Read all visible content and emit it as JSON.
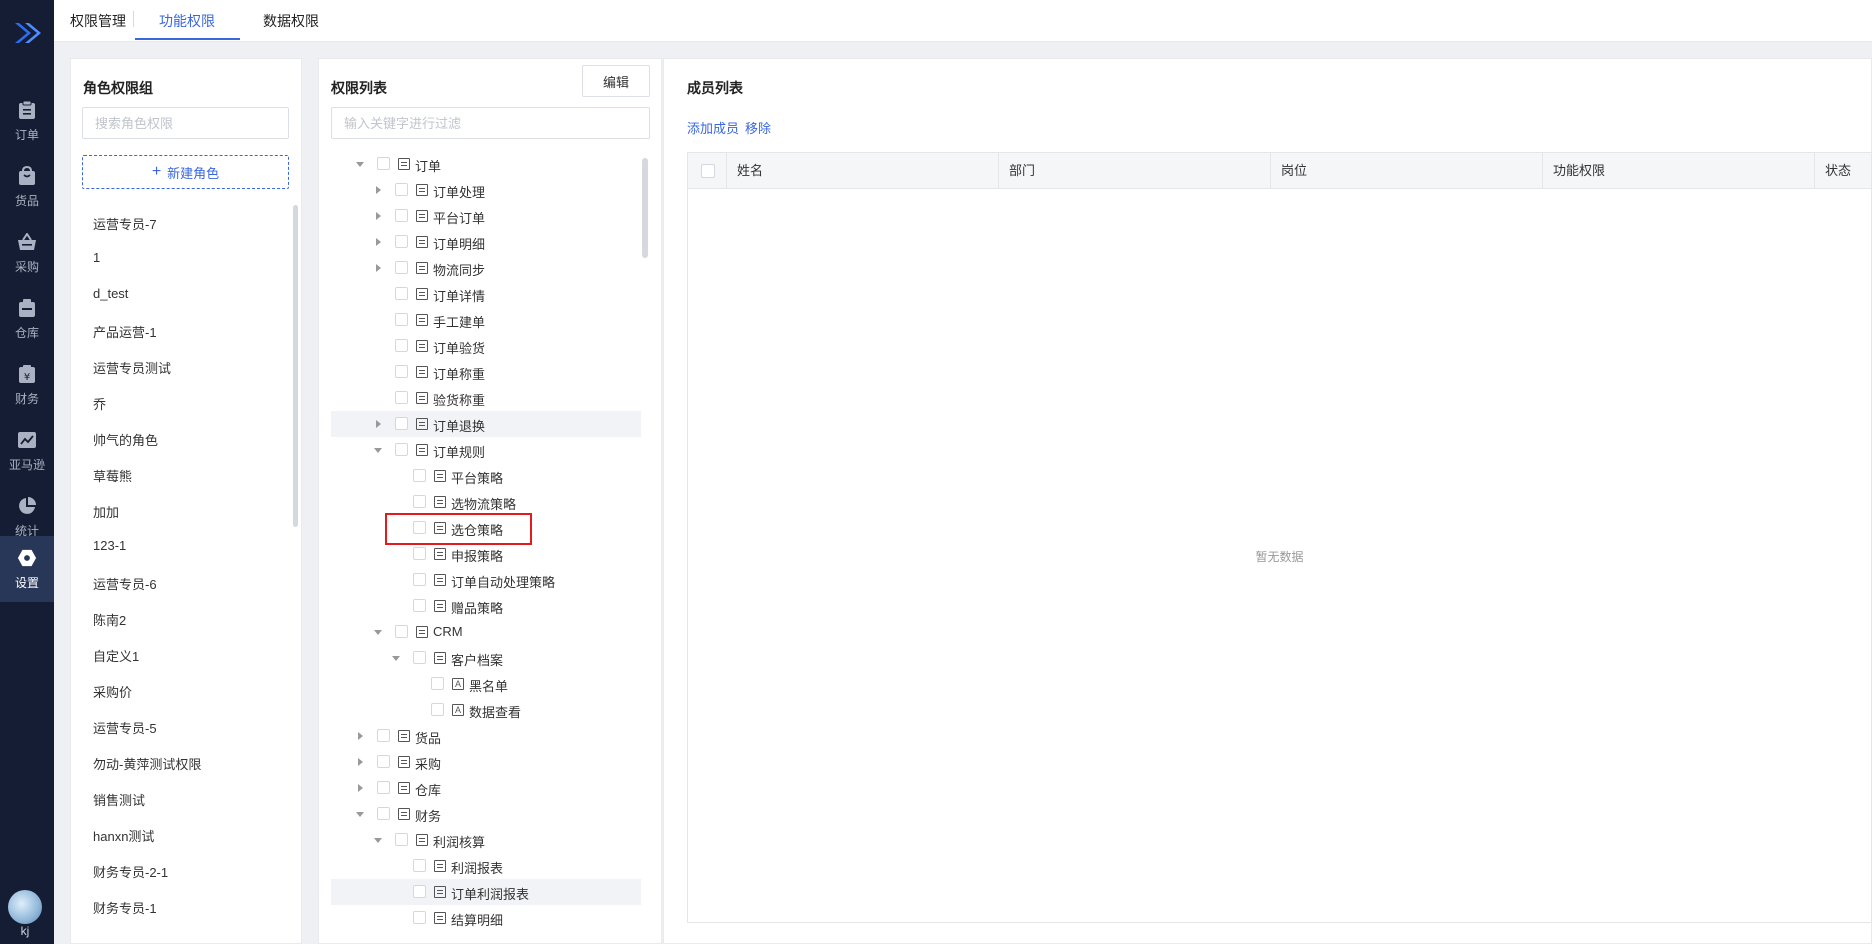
{
  "sidebar": {
    "items": [
      {
        "label": "订单",
        "icon": "clipboard-icon"
      },
      {
        "label": "货品",
        "icon": "shopping-bag-icon"
      },
      {
        "label": "采购",
        "icon": "basket-icon"
      },
      {
        "label": "仓库",
        "icon": "warehouse-icon"
      },
      {
        "label": "财务",
        "icon": "finance-icon"
      },
      {
        "label": "亚马逊",
        "icon": "trend-chart-icon"
      },
      {
        "label": "统计",
        "icon": "pie-chart-icon"
      },
      {
        "label": "设置",
        "icon": "settings-icon"
      }
    ],
    "active": "设置",
    "user_label": "kj"
  },
  "topbar": {
    "title": "权限管理",
    "tabs": [
      "功能权限",
      "数据权限"
    ],
    "active_tab": "功能权限"
  },
  "roles_panel": {
    "title": "角色权限组",
    "search_placeholder": "搜索角色权限",
    "new_role_label": "新建角色",
    "roles": [
      "运营专员-7",
      "1",
      "d_test",
      "产品运营-1",
      "运营专员测试",
      "乔",
      "帅气的角色",
      "草莓熊",
      "加加",
      "123-1",
      "运营专员-6",
      "陈南2",
      "自定义1",
      "采购价",
      "运营专员-5",
      "勿动-黄萍测试权限",
      "销售测试",
      "hanxn测试",
      "财务专员-2-1",
      "财务专员-1"
    ]
  },
  "permissions_panel": {
    "title": "权限列表",
    "edit_label": "编辑",
    "filter_placeholder": "输入关键字进行过滤",
    "tree": [
      {
        "label": "订单",
        "level": 0,
        "arrow": "down",
        "icon": "page-icon"
      },
      {
        "label": "订单处理",
        "level": 1,
        "arrow": "right",
        "icon": "page-icon"
      },
      {
        "label": "平台订单",
        "level": 1,
        "arrow": "right",
        "icon": "page-icon"
      },
      {
        "label": "订单明细",
        "level": 1,
        "arrow": "right",
        "icon": "page-icon"
      },
      {
        "label": "物流同步",
        "level": 1,
        "arrow": "right",
        "icon": "page-icon"
      },
      {
        "label": "订单详情",
        "level": 1,
        "arrow": "none",
        "icon": "page-icon"
      },
      {
        "label": "手工建单",
        "level": 1,
        "arrow": "none",
        "icon": "page-icon"
      },
      {
        "label": "订单验货",
        "level": 1,
        "arrow": "none",
        "icon": "page-icon"
      },
      {
        "label": "订单称重",
        "level": 1,
        "arrow": "none",
        "icon": "page-icon"
      },
      {
        "label": "验货称重",
        "level": 1,
        "arrow": "none",
        "icon": "page-icon"
      },
      {
        "label": "订单退换",
        "level": 1,
        "arrow": "right",
        "icon": "page-icon",
        "hover": true
      },
      {
        "label": "订单规则",
        "level": 1,
        "arrow": "down",
        "icon": "page-icon"
      },
      {
        "label": "平台策略",
        "level": 2,
        "arrow": "none",
        "icon": "page-icon"
      },
      {
        "label": "选物流策略",
        "level": 2,
        "arrow": "none",
        "icon": "page-icon"
      },
      {
        "label": "选仓策略",
        "level": 2,
        "arrow": "none",
        "icon": "page-icon"
      },
      {
        "label": "申报策略",
        "level": 2,
        "arrow": "none",
        "icon": "page-icon"
      },
      {
        "label": "订单自动处理策略",
        "level": 2,
        "arrow": "none",
        "icon": "page-icon"
      },
      {
        "label": "赠品策略",
        "level": 2,
        "arrow": "none",
        "icon": "page-icon"
      },
      {
        "label": "CRM",
        "level": 1,
        "arrow": "down",
        "icon": "page-icon"
      },
      {
        "label": "客户档案",
        "level": 2,
        "arrow": "down",
        "icon": "page-icon"
      },
      {
        "label": "黑名单",
        "level": 3,
        "arrow": "none",
        "icon": "action-icon"
      },
      {
        "label": "数据查看",
        "level": 3,
        "arrow": "none",
        "icon": "action-icon"
      },
      {
        "label": "货品",
        "level": 0,
        "arrow": "right",
        "icon": "page-icon"
      },
      {
        "label": "采购",
        "level": 0,
        "arrow": "right",
        "icon": "page-icon"
      },
      {
        "label": "仓库",
        "level": 0,
        "arrow": "right",
        "icon": "page-icon"
      },
      {
        "label": "财务",
        "level": 0,
        "arrow": "down",
        "icon": "page-icon"
      },
      {
        "label": "利润核算",
        "level": 1,
        "arrow": "down",
        "icon": "page-icon"
      },
      {
        "label": "利润报表",
        "level": 2,
        "arrow": "none",
        "icon": "page-icon"
      },
      {
        "label": "订单利润报表",
        "level": 2,
        "arrow": "none",
        "icon": "page-icon",
        "hover": true
      },
      {
        "label": "结算明细",
        "level": 2,
        "arrow": "none",
        "icon": "page-icon"
      }
    ],
    "action_icon_glyph": "A"
  },
  "members_panel": {
    "title": "成员列表",
    "add_member_label": "添加成员",
    "remove_label": "移除",
    "columns": [
      "姓名",
      "部门",
      "岗位",
      "功能权限",
      "状态"
    ],
    "empty_text": "暂无数据"
  },
  "colors": {
    "accent": "#3a67e0",
    "sidebar_bg": "#141d33",
    "highlight": "#e21c1c"
  }
}
